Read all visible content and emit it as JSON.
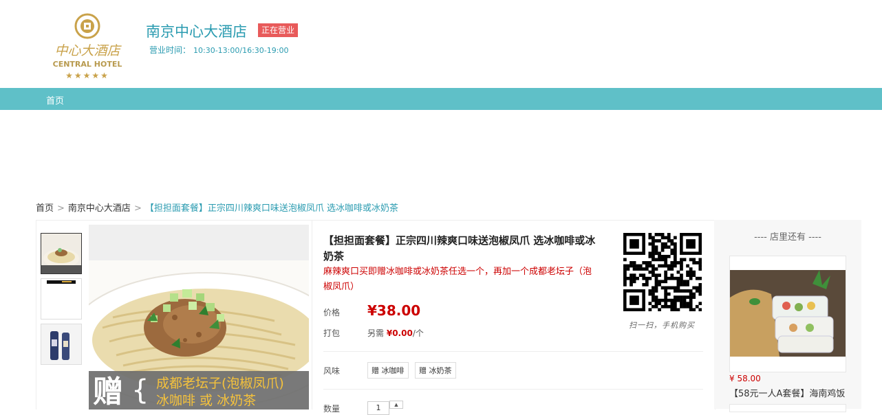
{
  "header": {
    "logo_text": "中心大酒店",
    "logo_subtext": "CENTRAL HOTEL",
    "shop_name": "南京中心大酒店",
    "status": "正在营业",
    "hours_label": "营业时间：",
    "hours_value": "10:30-13:00/16:30-19:00"
  },
  "nav": {
    "items": [
      {
        "label": "首页"
      }
    ]
  },
  "breadcrumb": {
    "home": "首页",
    "shop": "南京中心大酒店",
    "current": "【担担面套餐】正宗四川辣爽口味送泡椒凤爪 选冰咖啡或冰奶茶",
    "separator": ">"
  },
  "product": {
    "title": "【担担面套餐】正宗四川辣爽口味送泡椒凤爪 选冰咖啡或冰奶茶",
    "subtitle": "麻辣爽口买即赠冰咖啡或冰奶茶任选一个，再加一个成都老坛子（泡椒凤爪）",
    "price_label": "价格",
    "price": "¥38.00",
    "pack_label": "打包",
    "pack_prefix": "另需",
    "pack_value": "¥0.00",
    "pack_suffix": "/个",
    "flavor_label": "风味",
    "flavors": [
      "赠 冰咖啡",
      "赠 冰奶茶"
    ],
    "qty_label": "数量",
    "qty_value": "1",
    "qr_caption": "扫一扫，手机购买",
    "image_banner_big": "赠",
    "image_banner_line1": "成都老坛子(泡椒凤爪)",
    "image_banner_line2": "冰咖啡 或 冰奶茶"
  },
  "side": {
    "title": "---- 店里还有 ----",
    "items": [
      {
        "price": "¥ 58.00",
        "name": "【58元一人A套餐】海南鸡饭"
      }
    ]
  },
  "colors": {
    "accent": "#5fc0c8",
    "link": "#2a9bb0",
    "price": "#cc0000",
    "badge": "#e85a5a"
  }
}
